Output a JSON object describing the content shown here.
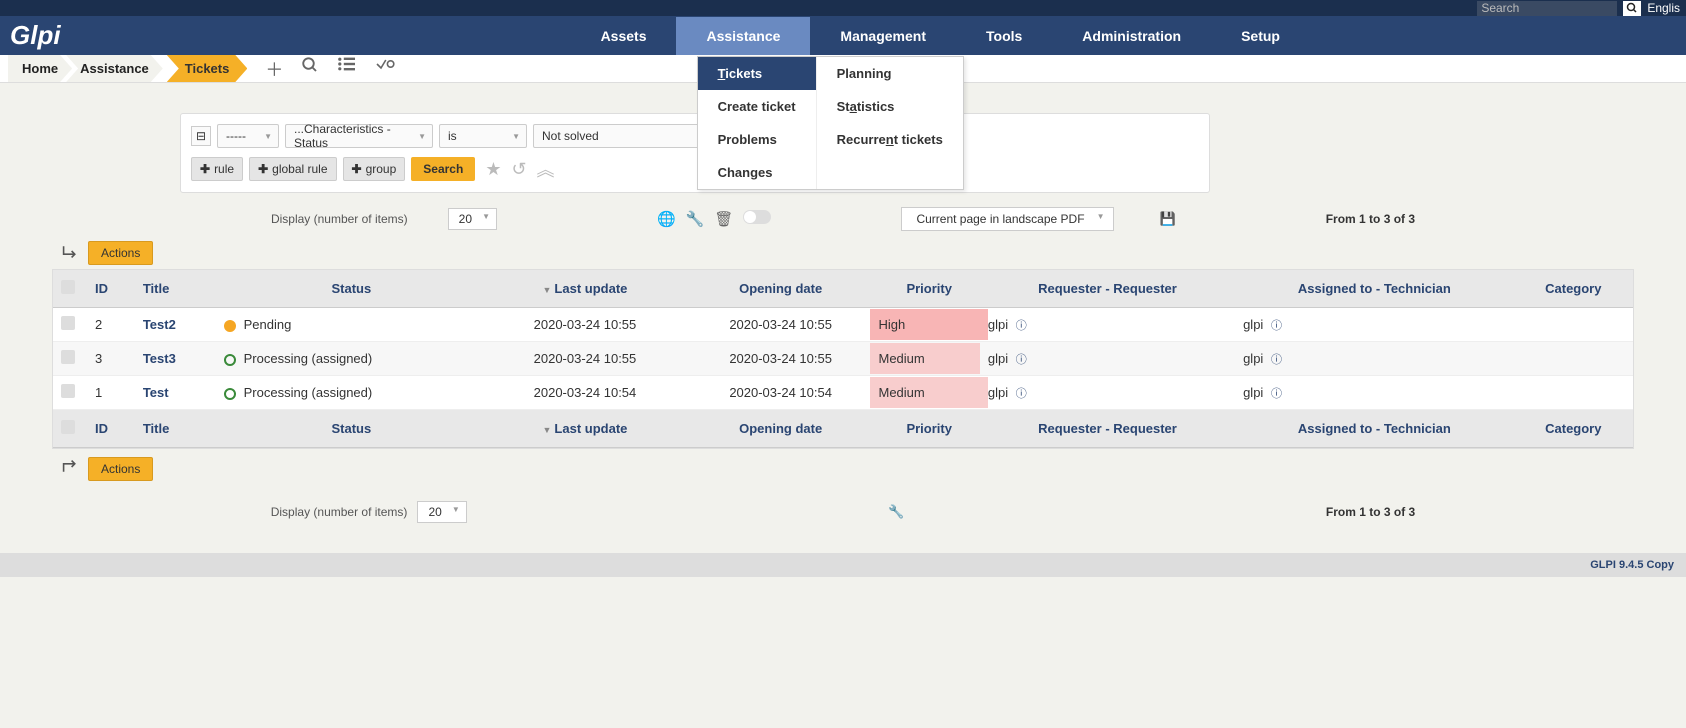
{
  "topbar": {
    "search_placeholder": "Search",
    "lang": "Englis"
  },
  "logo": "Glpi",
  "mainnav": [
    "Assets",
    "Assistance",
    "Management",
    "Tools",
    "Administration",
    "Setup"
  ],
  "dropdown": {
    "col1": [
      "Tickets",
      "Create ticket",
      "Problems",
      "Changes"
    ],
    "col2": [
      "Planning",
      "Statistics",
      "Recurrent tickets"
    ]
  },
  "breadcrumb": [
    "Home",
    "Assistance",
    "Tickets"
  ],
  "search": {
    "op": "-----",
    "field": "...Characteristics - Status",
    "cond": "is",
    "value": "Not solved",
    "rule": "rule",
    "global_rule": "global rule",
    "group": "group",
    "search_btn": "Search"
  },
  "pager": {
    "display_label": "Display (number of items)",
    "per_page": "20",
    "export": "Current page in landscape PDF",
    "range": "From 1 to 3 of 3"
  },
  "actions_btn": "Actions",
  "columns": [
    "ID",
    "Title",
    "Status",
    "Last update",
    "Opening date",
    "Priority",
    "Requester - Requester",
    "Assigned to - Technician",
    "Category"
  ],
  "rows": [
    {
      "id": "2",
      "title": "Test2",
      "status": "Pending",
      "status_kind": "pending",
      "last_update": "2020-03-24 10:55",
      "opening": "2020-03-24 10:55",
      "priority": "High",
      "priority_class": "priority-high",
      "requester": "glpi",
      "assigned": "glpi"
    },
    {
      "id": "3",
      "title": "Test3",
      "status": "Processing (assigned)",
      "status_kind": "proc",
      "last_update": "2020-03-24 10:55",
      "opening": "2020-03-24 10:55",
      "priority": "Medium",
      "priority_class": "priority-med",
      "requester": "glpi",
      "assigned": "glpi"
    },
    {
      "id": "1",
      "title": "Test",
      "status": "Processing (assigned)",
      "status_kind": "proc",
      "last_update": "2020-03-24 10:54",
      "opening": "2020-03-24 10:54",
      "priority": "Medium",
      "priority_class": "priority-med",
      "requester": "glpi",
      "assigned": "glpi"
    }
  ],
  "footer": "GLPI 9.4.5 Copy"
}
